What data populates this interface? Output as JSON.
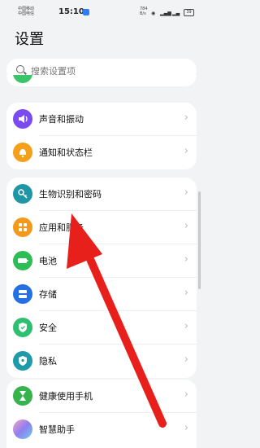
{
  "status": {
    "carrier1": "中国移动",
    "carrier2": "中国电信",
    "time": "15:10",
    "speed1": "784",
    "speed2": "B/s",
    "battery": "39"
  },
  "header": {
    "title": "设置"
  },
  "search": {
    "placeholder": "搜索设置项"
  },
  "group1": [
    {
      "label": "声音和振动",
      "icon": "speaker-icon",
      "color": "#7a4cf0"
    },
    {
      "label": "通知和状态栏",
      "icon": "bell-icon",
      "color": "#f5a01b"
    }
  ],
  "group2": [
    {
      "label": "生物识别和密码",
      "icon": "key-icon",
      "color": "#1f96a6"
    },
    {
      "label": "应用和服务",
      "icon": "grid-icon",
      "color": "#f39a1c"
    },
    {
      "label": "电池",
      "icon": "battery-icon",
      "color": "#2ebc55"
    },
    {
      "label": "存储",
      "icon": "storage-icon",
      "color": "#2670e6"
    },
    {
      "label": "安全",
      "icon": "shield-icon",
      "color": "#2fbf71"
    },
    {
      "label": "隐私",
      "icon": "privacy-icon",
      "color": "#1e9aa8"
    }
  ],
  "group3": [
    {
      "label": "健康使用手机",
      "icon": "hourglass-icon",
      "color": "#36b34c"
    },
    {
      "label": "智慧助手",
      "icon": "assistant-icon",
      "color": "#b97ae0"
    }
  ],
  "colors": {
    "arrow": "#e8201c",
    "background": "#f1f3f5"
  }
}
